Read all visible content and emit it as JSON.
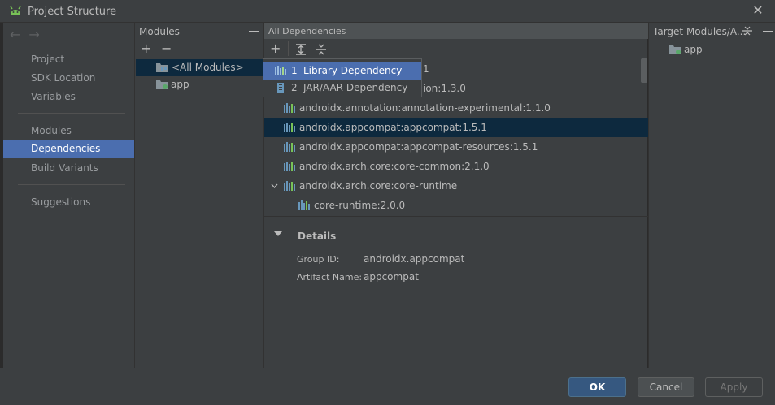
{
  "window": {
    "title": "Project Structure"
  },
  "left_nav": {
    "items": [
      {
        "label": "Project"
      },
      {
        "label": "SDK Location"
      },
      {
        "label": "Variables"
      },
      {
        "label": "Modules"
      },
      {
        "label": "Dependencies"
      },
      {
        "label": "Build Variants"
      },
      {
        "label": "Suggestions"
      }
    ]
  },
  "modules_pane": {
    "title": "Modules",
    "items": [
      {
        "label": "<All Modules>"
      },
      {
        "label": "app"
      }
    ]
  },
  "deps_pane": {
    "title": "All Dependencies",
    "rows": [
      {
        "label": "1"
      },
      {
        "label": "ion:1.3.0"
      },
      {
        "label": "androidx.annotation:annotation-experimental:1.1.0"
      },
      {
        "label": "androidx.appcompat:appcompat:1.5.1"
      },
      {
        "label": "androidx.appcompat:appcompat-resources:1.5.1"
      },
      {
        "label": "androidx.arch.core:core-common:2.1.0"
      },
      {
        "label": "androidx.arch.core:core-runtime"
      },
      {
        "label": "core-runtime:2.0.0"
      }
    ],
    "details": {
      "title": "Details",
      "group_id_label": "Group ID:",
      "group_id_value": "androidx.appcompat",
      "artifact_label": "Artifact Name:",
      "artifact_value": "appcompat"
    }
  },
  "add_menu": {
    "items": [
      {
        "num": "1",
        "label": "Library Dependency"
      },
      {
        "num": "2",
        "label": "JAR/AAR Dependency"
      }
    ]
  },
  "target_pane": {
    "title": "Target Modules/A...",
    "items": [
      {
        "label": "app"
      }
    ]
  },
  "footer": {
    "ok": "OK",
    "cancel": "Cancel",
    "apply": "Apply"
  },
  "colors": {
    "selection": "#4b6eaf",
    "row_selected": "#0d293e",
    "android_green": "#78c257",
    "lib_icon_blue": "#6897bb"
  }
}
